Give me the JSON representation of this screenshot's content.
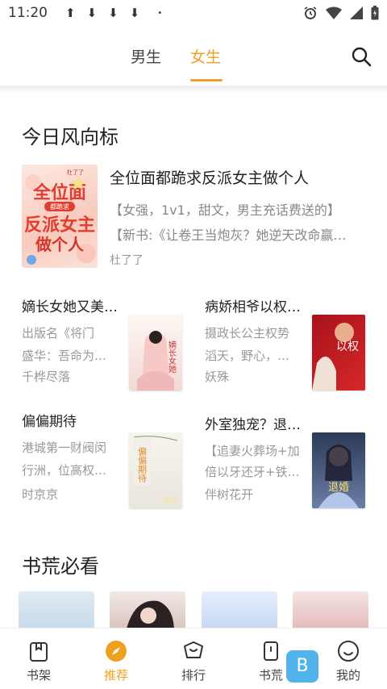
{
  "status_bar": {
    "time": "11:20",
    "download_arrows": [
      "⬆",
      "⬇",
      "⬇",
      "⬇"
    ],
    "dot": "•"
  },
  "tabs": {
    "male": "男生",
    "female": "女生",
    "active": "female"
  },
  "section_wind": {
    "title": "今日风向标"
  },
  "featured": {
    "title": "全位面都跪求反派女主做个人",
    "line1": "【女强，1v1，甜文，男主充话费送的】",
    "line2": "【新书:《让卷王当炮灰？她逆天改命赢…",
    "author": "杜了了",
    "cover_text": "全位面都跪求反派女主做个人",
    "cover_author": "杜了了"
  },
  "grid_books": [
    {
      "title": "嫡长女她又美…",
      "line1": "出版名《将门",
      "line2": "盛华：吾命为…",
      "author": "千桦尽落",
      "cover_text": "嫡长女她"
    },
    {
      "title": "病娇相爷以权…",
      "line1": "摄政长公主权势",
      "line2": "滔天，野心，…",
      "author": "妖殊",
      "cover_text": "以权"
    },
    {
      "title": "偏偏期待",
      "line1": "港城第一财阀闵",
      "line2": "行洲，位高权…",
      "author": "时京京",
      "cover_text": "偏偏期待"
    },
    {
      "title": "外室独宠？退…",
      "line1": "【追妻火葬场+加",
      "line2": "倍以牙还牙+铁…",
      "author": "伴树花开",
      "cover_text": "退婚"
    }
  ],
  "section_must": {
    "title": "书荒必看"
  },
  "strip_covers": [
    "cover-1",
    "cover-2",
    "cover-3",
    "cover-4"
  ],
  "bottom_nav": [
    {
      "label": "书架",
      "icon": "bookshelf-icon"
    },
    {
      "label": "推荐",
      "icon": "compass-icon",
      "active": true
    },
    {
      "label": "排行",
      "icon": "ranking-icon"
    },
    {
      "label": "书荒",
      "icon": "book-famine-icon"
    },
    {
      "label": "我的",
      "icon": "profile-icon"
    }
  ],
  "colors": {
    "accent": "#f0a020",
    "text": "#222222",
    "muted": "#999999"
  }
}
